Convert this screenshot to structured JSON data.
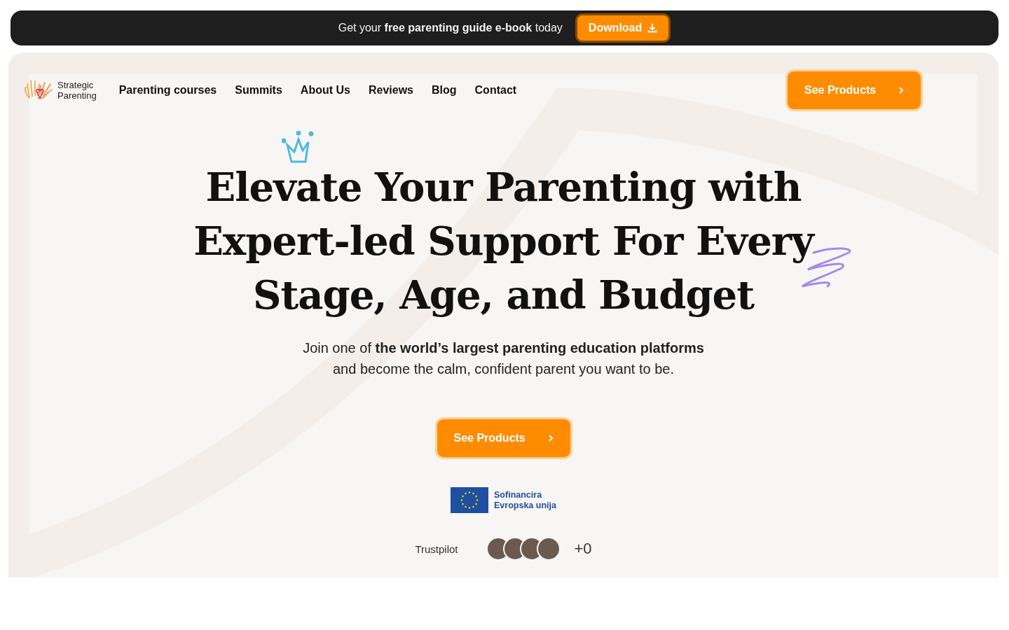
{
  "banner": {
    "text": "Get your **free parenting guide e-book** today",
    "button": "Download"
  },
  "logo": {
    "line1": "Strategic",
    "line2": "Parenting"
  },
  "nav": [
    "Parenting courses",
    "Summits",
    "About Us",
    "Reviews",
    "Blog",
    "Contact"
  ],
  "nav_button": "See Products",
  "hero": {
    "title_lines": [
      "Elevate Your Parenting with",
      "Expert-led Support For Every",
      "Stage, Age, and Budget"
    ],
    "subtitle_lines": [
      "Join one of **the world’s largest parenting education platforms**",
      "and become the calm, confident parent you want to be."
    ],
    "button": "See Products"
  },
  "eu": {
    "line1": "Sofinancira",
    "line2": "Evropska unija"
  },
  "social": {
    "trustpilot": "Trustpilot",
    "count": "+0"
  }
}
